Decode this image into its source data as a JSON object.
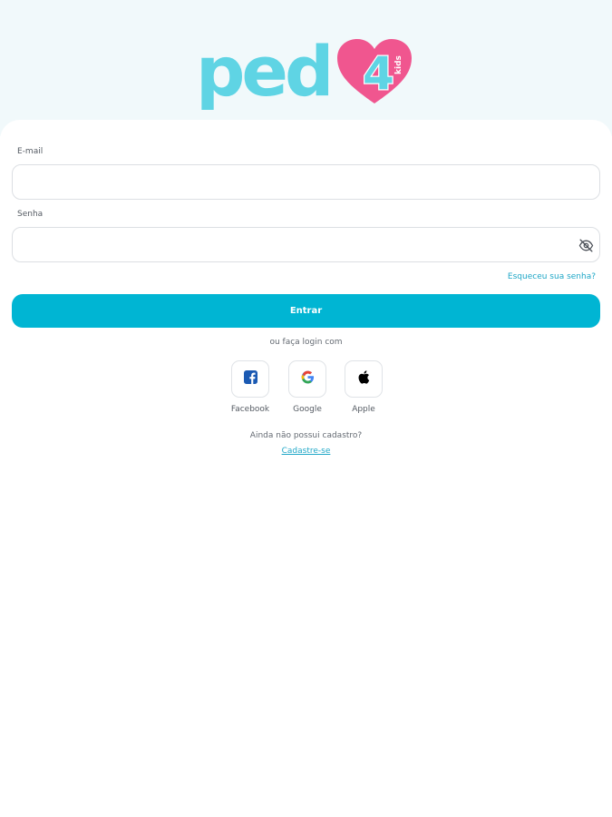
{
  "logo": {
    "text": "ped",
    "number": "4",
    "tag": "kids",
    "colors": {
      "text": "#5fd4e4",
      "heart": "#f0568f"
    }
  },
  "form": {
    "email_label": "E-mail",
    "email_value": "",
    "password_label": "Senha",
    "password_value": "",
    "password_toggle_icon": "eye-off-icon",
    "forgot_link": "Esqueceu sua senha?",
    "submit_label": "Entrar"
  },
  "social": {
    "prompt": "ou faça login com",
    "providers": [
      {
        "label": "Facebook",
        "icon": "facebook-icon"
      },
      {
        "label": "Google",
        "icon": "google-icon"
      },
      {
        "label": "Apple",
        "icon": "apple-icon"
      }
    ]
  },
  "signup": {
    "prompt": "Ainda não possui cadastro?",
    "link": "Cadastre-se"
  },
  "colors": {
    "accent": "#00b5d3",
    "link": "#1fa7c7",
    "header_bg": "#f1f9fb"
  }
}
